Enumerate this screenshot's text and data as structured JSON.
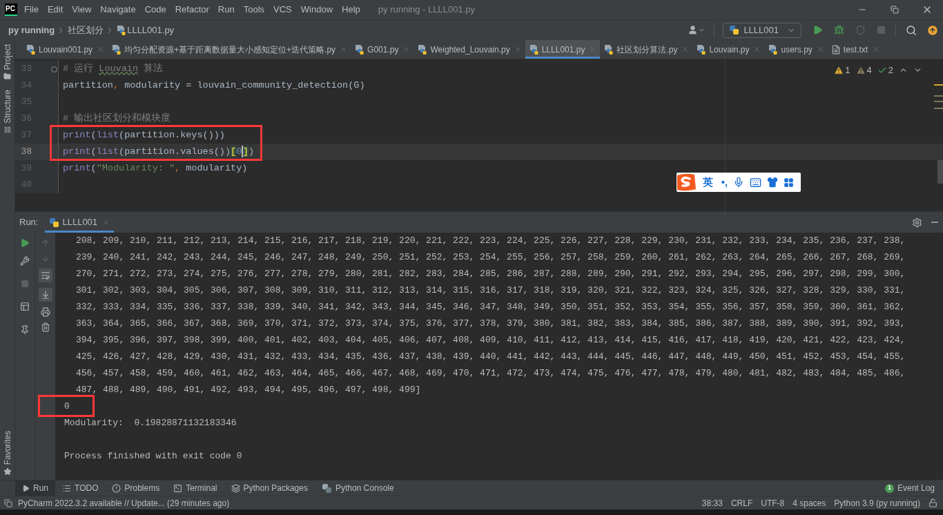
{
  "title_bar": {
    "logo": "PC",
    "menus": [
      "File",
      "Edit",
      "View",
      "Navigate",
      "Code",
      "Refactor",
      "Run",
      "Tools",
      "VCS",
      "Window",
      "Help"
    ],
    "title": "py running - LLLL001.py"
  },
  "nav_bar": {
    "breadcrumbs": [
      "py running",
      "社区划分",
      "LLLL001.py"
    ],
    "run_config": "LLLL001"
  },
  "side_stripe": {
    "top": [
      "Project",
      "Structure"
    ],
    "bottom": [
      "Favorites"
    ]
  },
  "editor_tabs": [
    {
      "label": "Louvain001.py",
      "kind": "py",
      "selected": false
    },
    {
      "label": "均匀分配资源+基于距离数据量大小感知定位+迭代策略.py",
      "kind": "py",
      "selected": false
    },
    {
      "label": "G001.py",
      "kind": "py",
      "selected": false
    },
    {
      "label": "Weighted_Louvain.py",
      "kind": "py",
      "selected": false
    },
    {
      "label": "LLLL001.py",
      "kind": "py",
      "selected": true
    },
    {
      "label": "社区划分算法.py",
      "kind": "py",
      "selected": false
    },
    {
      "label": "Louvain.py",
      "kind": "py",
      "selected": false
    },
    {
      "label": "users.py",
      "kind": "py",
      "selected": false
    },
    {
      "label": "test.txt",
      "kind": "txt",
      "selected": false
    }
  ],
  "inspections": [
    {
      "kind": "warning",
      "count": "1"
    },
    {
      "kind": "weak-warning",
      "count": "4"
    },
    {
      "kind": "typo",
      "count": "2"
    }
  ],
  "code_lines": [
    {
      "number": "33",
      "current": false,
      "folded_start": true,
      "tokens": [
        {
          "kind": "comment",
          "text": "# 运行 "
        },
        {
          "kind": "typo",
          "text": "Louvain"
        },
        {
          "kind": "comment",
          "text": " 算法"
        }
      ]
    },
    {
      "number": "34",
      "current": false,
      "tokens": [
        {
          "kind": "plain",
          "text": "partition"
        },
        {
          "kind": "punct",
          "text": ", "
        },
        {
          "kind": "plain",
          "text": "modularity = louvain_community_detection(G)"
        }
      ]
    },
    {
      "number": "35",
      "current": false
    },
    {
      "number": "36",
      "current": false,
      "tokens": [
        {
          "kind": "comment",
          "text": "# 输出社区划分和模块度"
        }
      ]
    },
    {
      "number": "37",
      "current": false,
      "tokens": [
        {
          "kind": "builtin",
          "text": "print"
        },
        {
          "kind": "plain",
          "text": "("
        },
        {
          "kind": "builtin",
          "text": "list"
        },
        {
          "kind": "plain",
          "text": "(partition.keys()))"
        }
      ]
    },
    {
      "number": "38",
      "current": true,
      "tokens": [
        {
          "kind": "builtin",
          "text": "print"
        },
        {
          "kind": "plain",
          "text": "("
        },
        {
          "kind": "builtin",
          "text": "list"
        },
        {
          "kind": "plain",
          "text": "(partition.values())"
        },
        {
          "kind": "match",
          "text": "["
        },
        {
          "kind": "number",
          "text": "0"
        },
        {
          "kind": "caret"
        },
        {
          "kind": "match",
          "text": "]"
        },
        {
          "kind": "plain",
          "text": ")"
        }
      ]
    },
    {
      "number": "39",
      "current": false,
      "tokens": [
        {
          "kind": "builtin",
          "text": "print"
        },
        {
          "kind": "plain",
          "text": "("
        },
        {
          "kind": "string",
          "text": "\"Modularity: \""
        },
        {
          "kind": "punct",
          "text": ", "
        },
        {
          "kind": "plain",
          "text": "modularity)"
        }
      ]
    },
    {
      "number": "40",
      "current": false
    }
  ],
  "ime_toolbar": {
    "mode": "英",
    "punctuation": "•,"
  },
  "run_panel": {
    "label": "Run:",
    "tab": "LLLL001",
    "output": [
      {
        "kind": "wrapped",
        "text": "208, 209, 210, 211, 212, 213, 214, 215, 216, 217, 218, 219, 220, 221, 222, 223, 224, 225, 226, 227, 228, 229, 230, 231, 232, 233, 234, 235, 236, 237, 238,"
      },
      {
        "kind": "wrapped",
        "text": "239, 240, 241, 242, 243, 244, 245, 246, 247, 248, 249, 250, 251, 252, 253, 254, 255, 256, 257, 258, 259, 260, 261, 262, 263, 264, 265, 266, 267, 268, 269,"
      },
      {
        "kind": "wrapped",
        "text": "270, 271, 272, 273, 274, 275, 276, 277, 278, 279, 280, 281, 282, 283, 284, 285, 286, 287, 288, 289, 290, 291, 292, 293, 294, 295, 296, 297, 298, 299, 300,"
      },
      {
        "kind": "wrapped",
        "text": "301, 302, 303, 304, 305, 306, 307, 308, 309, 310, 311, 312, 313, 314, 315, 316, 317, 318, 319, 320, 321, 322, 323, 324, 325, 326, 327, 328, 329, 330, 331,"
      },
      {
        "kind": "wrapped",
        "text": "332, 333, 334, 335, 336, 337, 338, 339, 340, 341, 342, 343, 344, 345, 346, 347, 348, 349, 350, 351, 352, 353, 354, 355, 356, 357, 358, 359, 360, 361, 362,"
      },
      {
        "kind": "wrapped",
        "text": "363, 364, 365, 366, 367, 368, 369, 370, 371, 372, 373, 374, 375, 376, 377, 378, 379, 380, 381, 382, 383, 384, 385, 386, 387, 388, 389, 390, 391, 392, 393,"
      },
      {
        "kind": "wrapped",
        "text": "394, 395, 396, 397, 398, 399, 400, 401, 402, 403, 404, 405, 406, 407, 408, 409, 410, 411, 412, 413, 414, 415, 416, 417, 418, 419, 420, 421, 422, 423, 424,"
      },
      {
        "kind": "wrapped",
        "text": "425, 426, 427, 428, 429, 430, 431, 432, 433, 434, 435, 436, 437, 438, 439, 440, 441, 442, 443, 444, 445, 446, 447, 448, 449, 450, 451, 452, 453, 454, 455,"
      },
      {
        "kind": "wrapped",
        "text": "456, 457, 458, 459, 460, 461, 462, 463, 464, 465, 466, 467, 468, 469, 470, 471, 472, 473, 474, 475, 476, 477, 478, 479, 480, 481, 482, 483, 484, 485, 486,"
      },
      {
        "kind": "wrapped",
        "text": "487, 488, 489, 490, 491, 492, 493, 494, 495, 496, 497, 498, 499]"
      },
      {
        "kind": "line",
        "text": "0"
      },
      {
        "kind": "line",
        "text": "Modularity:  0.19828871132183346"
      },
      {
        "kind": "blank"
      },
      {
        "kind": "line",
        "text": "Process finished with exit code 0"
      }
    ]
  },
  "tool_tabs": [
    {
      "label": "Run",
      "kind": "run",
      "selected": true
    },
    {
      "label": "TODO",
      "kind": "todo",
      "selected": false
    },
    {
      "label": "Problems",
      "kind": "problems",
      "selected": false
    },
    {
      "label": "Terminal",
      "kind": "terminal",
      "selected": false
    },
    {
      "label": "Python Packages",
      "kind": "packages",
      "selected": false
    },
    {
      "label": "Python Console",
      "kind": "console",
      "selected": false
    }
  ],
  "event_log": {
    "badge": "1",
    "label": "Event Log"
  },
  "status_bar": {
    "message": "PyCharm 2022.3.2 available // Update... (29 minutes ago)",
    "items": [
      "38:33",
      "CRLF",
      "UTF-8",
      "4 spaces",
      "Python 3.9 (py running)"
    ]
  }
}
